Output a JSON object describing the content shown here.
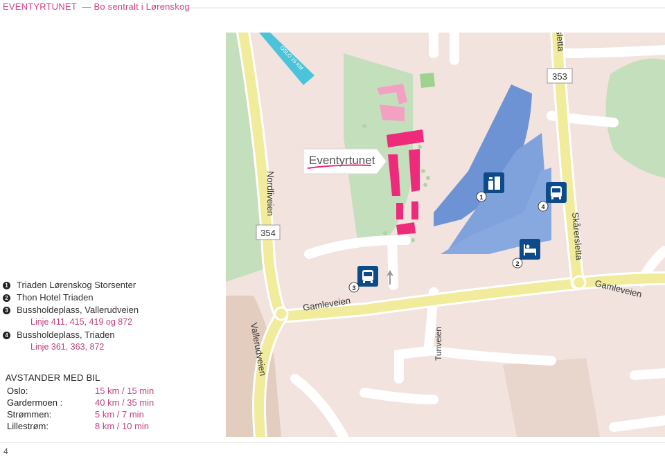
{
  "header": {
    "brand": "EVENTYRTUNET",
    "subtitle": "Bo sentralt i Lørenskog"
  },
  "map": {
    "roads": {
      "nordliveien": "Nordliveien",
      "skarersletta": "Skårersletta",
      "skarersletta_top": "ersletta",
      "gamleveien_left": "Gamleveien",
      "gamleveien_right": "Gamleveien",
      "vallerudveien": "Vallerudveien",
      "tunveien": "Tunveien"
    },
    "route_badges": {
      "r353": "353",
      "r354": "354"
    },
    "oslo_arrow": "OSLO 15 KM",
    "eventyrtunet_sign": "Eventyrtunet",
    "markers": [
      {
        "number": "1",
        "icon": "building-icon"
      },
      {
        "number": "2",
        "icon": "hotel-bed-icon"
      },
      {
        "number": "3",
        "icon": "bus-icon"
      },
      {
        "number": "4",
        "icon": "bus-icon"
      }
    ],
    "colors": {
      "land": "#f2e3df",
      "park": "#c4dfbb",
      "road": "#f1eb9c",
      "road_edge": "#ffffff",
      "building_blue": "#6e93d4",
      "building_pink": "#ee2b7b",
      "icon_blue": "#0d4a8a"
    }
  },
  "legend": [
    {
      "number": "1",
      "label": "Triaden Lørenskog Storsenter"
    },
    {
      "number": "2",
      "label": "Thon Hotel Triaden"
    },
    {
      "number": "3",
      "label": "Bussholdeplass, Vallerudveien",
      "sub": "Linje 411, 415, 419 og 872"
    },
    {
      "number": "4",
      "label": "Bussholdeplass, Triaden",
      "sub": "Linje 361, 363, 872"
    }
  ],
  "distances": {
    "heading": "AVSTANDER MED BIL",
    "rows": [
      {
        "place": "Oslo:",
        "value": "15 km / 15 min"
      },
      {
        "place": "Gardermoen :",
        "value": "40 km / 35 min"
      },
      {
        "place": "Strømmen:",
        "value": "5 km / 7 min"
      },
      {
        "place": "Lillestrøm:",
        "value": "8 km / 10 min"
      }
    ]
  },
  "page_number": "4"
}
